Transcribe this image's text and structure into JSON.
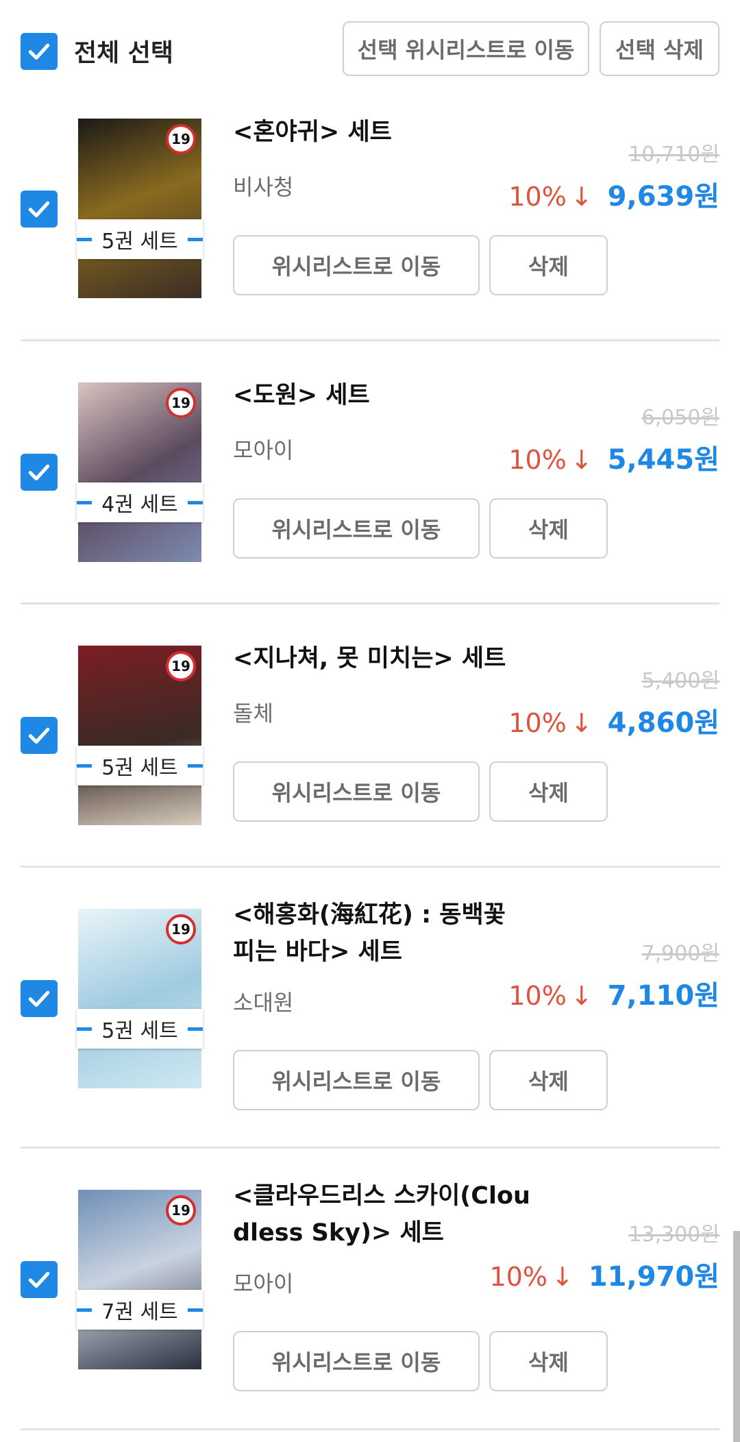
{
  "header": {
    "select_all_label": "전체 선택",
    "move_selected_label": "선택 위시리스트로 이동",
    "delete_selected_label": "선택 삭제"
  },
  "items": [
    {
      "title": "<혼야귀> 세트",
      "author": "비사청",
      "set_label": "5권 세트",
      "age_rating": "19",
      "original_price": "10,710원",
      "discount": "10%",
      "price": "9,639원",
      "wishlist_label": "위시리스트로 이동",
      "delete_label": "삭제",
      "cover_colors": [
        "#1b1a17",
        "#8a6a1f",
        "#3a2d24"
      ]
    },
    {
      "title": "<도원> 세트",
      "author": "모아이",
      "set_label": "4권 세트",
      "age_rating": "19",
      "original_price": "6,050원",
      "discount": "10%",
      "price": "5,445원",
      "wishlist_label": "위시리스트로 이동",
      "delete_label": "삭제",
      "cover_colors": [
        "#d9c4c0",
        "#5c4a5f",
        "#7d8bb0"
      ]
    },
    {
      "title": "<지나쳐, 못 미치는> 세트",
      "author": "돌체",
      "set_label": "5권 세트",
      "age_rating": "19",
      "original_price": "5,400원",
      "discount": "10%",
      "price": "4,860원",
      "wishlist_label": "위시리스트로 이동",
      "delete_label": "삭제",
      "cover_colors": [
        "#7b1e24",
        "#3a2a25",
        "#d7cbbd"
      ]
    },
    {
      "title": "<해홍화(海紅花) : 동백꽃 피는 바다> 세트",
      "author": "소대원",
      "set_label": "5권 세트",
      "age_rating": "19",
      "original_price": "7,900원",
      "discount": "10%",
      "price": "7,110원",
      "wishlist_label": "위시리스트로 이동",
      "delete_label": "삭제",
      "cover_colors": [
        "#cfe8f2",
        "#9fcbe0",
        "#e9f4f8"
      ]
    },
    {
      "title": "<클라우드리스 스카이(Cloudless Sky)> 세트",
      "author": "모아이",
      "set_label": "7권 세트",
      "age_rating": "19",
      "original_price": "13,300원",
      "discount": "10%",
      "price": "11,970원",
      "wishlist_label": "위시리스트로 이동",
      "delete_label": "삭제",
      "cover_colors": [
        "#6f8fb8",
        "#2a2f3c",
        "#c9d3df"
      ]
    }
  ]
}
